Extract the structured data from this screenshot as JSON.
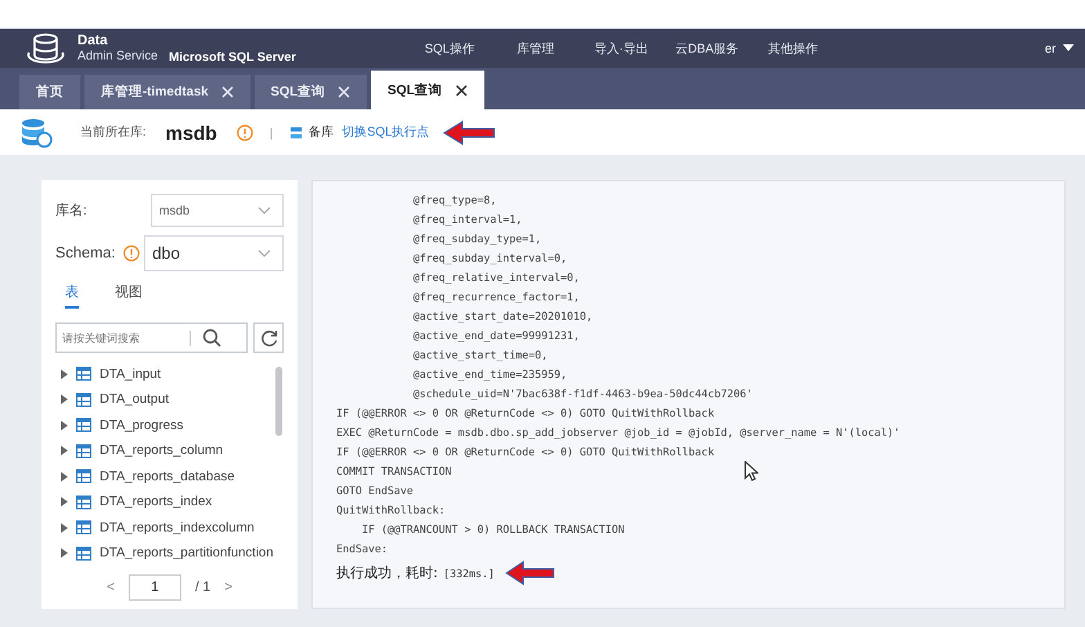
{
  "header": {
    "brand_title": "Data",
    "brand_subtitle": "Admin Service",
    "product": "Microsoft SQL Server",
    "nav": [
      "SQL操作",
      "库管理",
      "导入·导出",
      "云DBA服务",
      "其他操作"
    ],
    "user": "er"
  },
  "tabs": [
    {
      "label": "首页",
      "selected": false,
      "closable": false
    },
    {
      "label": "库管理-timedtask",
      "selected": false,
      "closable": true
    },
    {
      "label": "SQL查询",
      "selected": false,
      "closable": true
    },
    {
      "label": "SQL查询",
      "selected": true,
      "closable": true
    }
  ],
  "info_bar": {
    "label": "当前所在库:",
    "database": "msdb",
    "separator": "|",
    "role": "备库",
    "switch_link": "切换SQL执行点"
  },
  "left_panel": {
    "db_label": "库名:",
    "db_value": "msdb",
    "schema_label": "Schema:",
    "schema_value": "dbo",
    "subtabs": [
      {
        "label": "表",
        "selected": true
      },
      {
        "label": "视图",
        "selected": false
      }
    ],
    "search": {
      "placeholder": "请按关键词搜索"
    },
    "tables": [
      "DTA_input",
      "DTA_output",
      "DTA_progress",
      "DTA_reports_column",
      "DTA_reports_database",
      "DTA_reports_index",
      "DTA_reports_indexcolumn",
      "DTA_reports_partitionfunction"
    ],
    "pagination": {
      "prev": "<",
      "page": "1",
      "total": "/ 1",
      "next": ">"
    }
  },
  "code": [
    "            @freq_type=8,",
    "            @freq_interval=1,",
    "            @freq_subday_type=1,",
    "            @freq_subday_interval=0,",
    "            @freq_relative_interval=0,",
    "            @freq_recurrence_factor=1,",
    "            @active_start_date=20201010,",
    "            @active_end_date=99991231,",
    "            @active_start_time=0,",
    "            @active_end_time=235959,",
    "            @schedule_uid=N'7bac638f-f1df-4463-b9ea-50dc44cb7206'",
    "IF (@@ERROR <> 0 OR @ReturnCode <> 0) GOTO QuitWithRollback",
    "EXEC @ReturnCode = msdb.dbo.sp_add_jobserver @job_id = @jobId, @server_name = N'(local)'",
    "IF (@@ERROR <> 0 OR @ReturnCode <> 0) GOTO QuitWithRollback",
    "COMMIT TRANSACTION",
    "GOTO EndSave",
    "QuitWithRollback:",
    "    IF (@@TRANCOUNT > 0) ROLLBACK TRANSACTION",
    "EndSave:"
  ],
  "result": {
    "label": "执行成功，耗时:",
    "time": "[332ms.]"
  }
}
